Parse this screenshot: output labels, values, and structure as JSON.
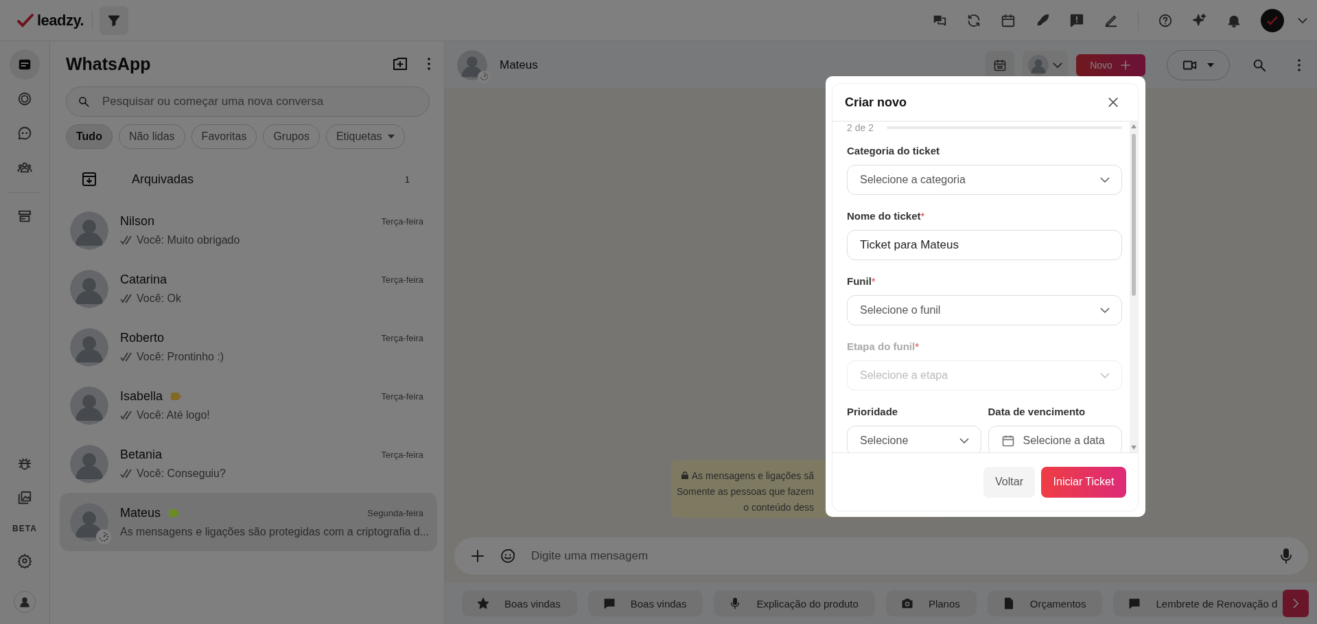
{
  "top_bar": {
    "logo": "leadzy."
  },
  "rail": {
    "top_items": [
      {
        "kind": "chats",
        "selected": true
      },
      {
        "kind": "status",
        "selected": false
      },
      {
        "kind": "channels",
        "selected": false
      },
      {
        "kind": "communities",
        "selected": false
      },
      {
        "kind": "store",
        "selected": false
      }
    ],
    "bottom_items": [
      {
        "kind": "bug",
        "selected": false
      },
      {
        "kind": "gallery",
        "selected": false
      }
    ],
    "beta_label": "BETA"
  },
  "chat_list": {
    "title": "WhatsApp",
    "search": {
      "placeholder": "Pesquisar ou começar uma nova conversa"
    },
    "filters": [
      {
        "label": "Tudo",
        "selected": true,
        "dropdown": false
      },
      {
        "label": "Não lidas",
        "selected": false,
        "dropdown": false
      },
      {
        "label": "Favoritas",
        "selected": false,
        "dropdown": false
      },
      {
        "label": "Grupos",
        "selected": false,
        "dropdown": false
      },
      {
        "label": "Etiquetas",
        "selected": false,
        "dropdown": true
      }
    ],
    "archived": {
      "label": "Arquivadas",
      "count": "1"
    },
    "chats": [
      {
        "name": "Nilson",
        "time": "Terça-feira",
        "preview": "Você: Muito obrigado",
        "read": true,
        "selected": false
      },
      {
        "name": "Catarina",
        "time": "Terça-feira",
        "preview": "Você: Ok",
        "read": true,
        "selected": false
      },
      {
        "name": "Roberto",
        "time": "Terça-feira",
        "preview": "Você: Prontinho :)",
        "read": true,
        "selected": false
      },
      {
        "name": "Isabella",
        "time": "Terça-feira",
        "preview": "Você: Até logo!",
        "read": true,
        "selected": false,
        "color": "#806a24"
      },
      {
        "name": "Betania",
        "time": "Terça-feira",
        "preview": "Você: Conseguiu?",
        "read": true,
        "selected": false
      },
      {
        "name": "Mateus",
        "time": "Segunda-feira",
        "preview": "As mensagens e ligações são protegidas com a criptografia d...",
        "read": false,
        "selected": true,
        "color": "#6b8c22"
      }
    ]
  },
  "conversation": {
    "contact": "Mateus",
    "new_button": "Novo",
    "encryption_note": [
      "As mensagens e ligações sã",
      "Somente as pessoas que fazem",
      "o conteúdo dess"
    ],
    "composer": {
      "placeholder": "Digite uma mensagem"
    },
    "quick_replies": [
      {
        "label": "Boas vindas",
        "kind": "star"
      },
      {
        "label": "Boas vindas",
        "kind": "chat"
      },
      {
        "label": "Explicação do produto",
        "kind": "mic"
      },
      {
        "label": "Planos",
        "kind": "camera"
      },
      {
        "label": "Orçamentos",
        "kind": "file"
      },
      {
        "label": "Lembrete de Renovação d",
        "kind": "chat"
      }
    ]
  },
  "modal": {
    "title": "Criar novo",
    "step": "2 de 2",
    "step_bar": {
      "level": 1
    },
    "rows": [
      [
        {
          "label": "Categoria do ticket",
          "kind": "select",
          "placeholder": "Selecione a categoria",
          "disabled": false
        }
      ],
      [
        {
          "label": "Nome do ticket",
          "marker": "*",
          "kind": "text",
          "value": "Ticket para Mateus",
          "disabled": false
        }
      ],
      [
        {
          "label": "Funil",
          "marker": "*",
          "kind": "select",
          "placeholder": "Selecione o funil",
          "disabled": false
        }
      ],
      [
        {
          "label": "Etapa do funil",
          "marker": "*",
          "kind": "select",
          "placeholder": "Selecione a etapa",
          "disabled": true
        }
      ],
      [
        {
          "label": "Prioridade",
          "kind": "select",
          "placeholder": "Selecione",
          "disabled": false
        },
        {
          "label": "Data de vencimento",
          "kind": "date",
          "placeholder": "Selecione a data",
          "disabled": false
        }
      ]
    ],
    "buttons": [
      {
        "label": "Voltar",
        "kind": "secondary"
      },
      {
        "label": "Iniciar Ticket",
        "kind": "primary"
      }
    ]
  }
}
